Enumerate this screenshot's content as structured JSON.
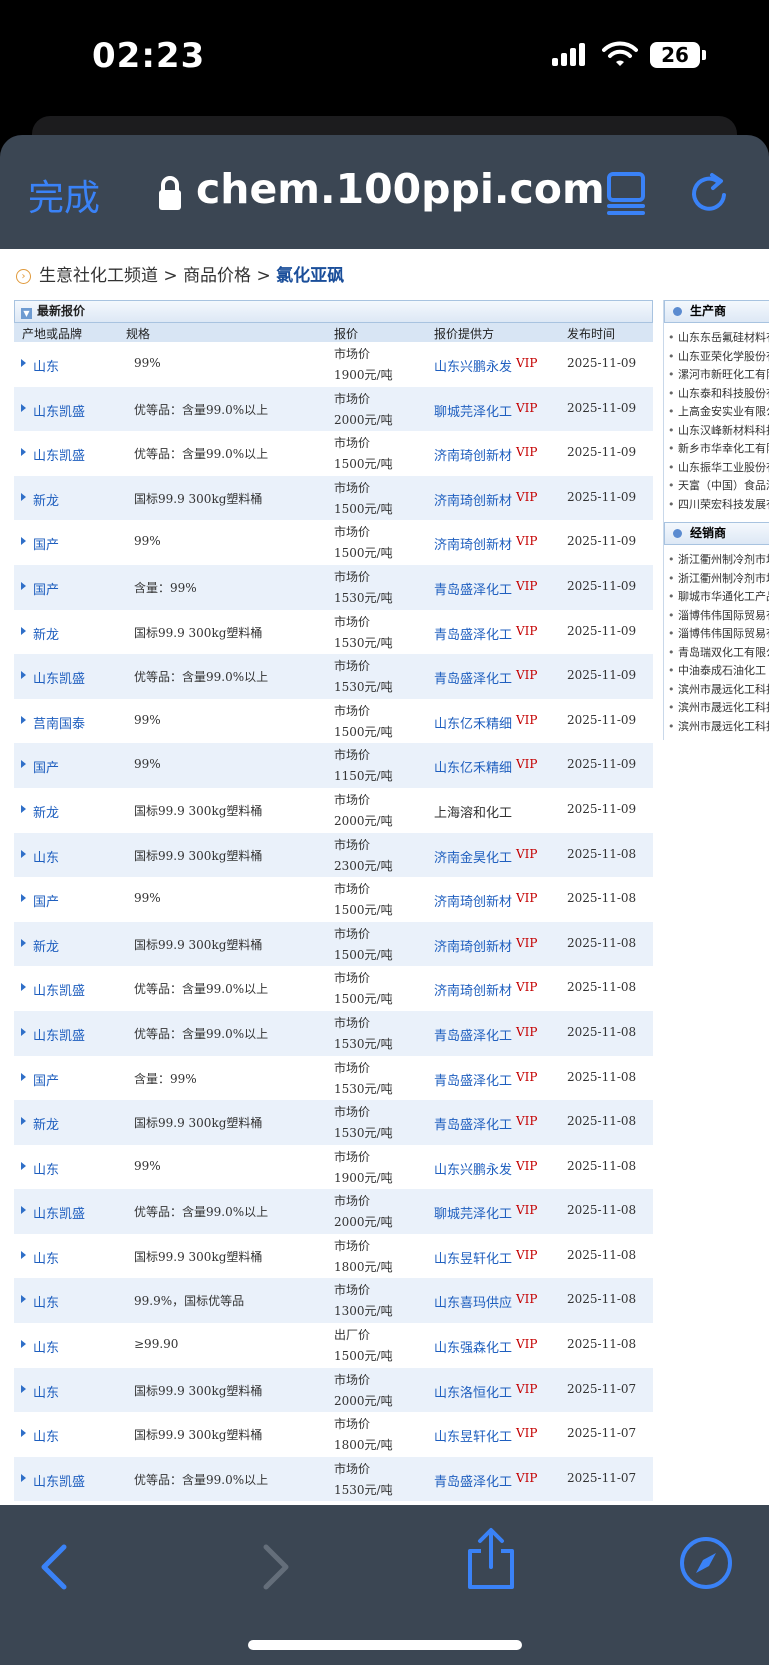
{
  "status": {
    "time": "02:23",
    "battery": "26"
  },
  "browser": {
    "done_label": "完成",
    "url": "chem.100ppi.com"
  },
  "breadcrumb": {
    "part1": "生意社化工频道",
    "sep": " > ",
    "part2": "商品价格",
    "current": "氯化亚砜"
  },
  "quotes": {
    "title": "最新报价",
    "headers": {
      "origin": "产地或品牌",
      "spec": "规格",
      "price": "报价",
      "supplier": "报价提供方",
      "date": "发布时间"
    },
    "rows": [
      {
        "origin": "山东",
        "spec": "99%",
        "ptype": "市场价",
        "price": "1900元/吨",
        "supplier": "山东兴鹏永发",
        "vip": "VIP",
        "date": "2025-11-09"
      },
      {
        "origin": "山东凯盛",
        "spec": "优等品：含量99.0%以上",
        "ptype": "市场价",
        "price": "2000元/吨",
        "supplier": "聊城芫泽化工",
        "vip": "VIP",
        "date": "2025-11-09"
      },
      {
        "origin": "山东凯盛",
        "spec": "优等品：含量99.0%以上",
        "ptype": "市场价",
        "price": "1500元/吨",
        "supplier": "济南琦创新材",
        "vip": "VIP",
        "date": "2025-11-09"
      },
      {
        "origin": "新龙",
        "spec": "国标99.9 300kg塑料桶",
        "ptype": "市场价",
        "price": "1500元/吨",
        "supplier": "济南琦创新材",
        "vip": "VIP",
        "date": "2025-11-09"
      },
      {
        "origin": "国产",
        "spec": "99%",
        "ptype": "市场价",
        "price": "1500元/吨",
        "supplier": "济南琦创新材",
        "vip": "VIP",
        "date": "2025-11-09"
      },
      {
        "origin": "国产",
        "spec": "含量：99%",
        "ptype": "市场价",
        "price": "1530元/吨",
        "supplier": "青岛盛泽化工",
        "vip": "VIP",
        "date": "2025-11-09"
      },
      {
        "origin": "新龙",
        "spec": "国标99.9 300kg塑料桶",
        "ptype": "市场价",
        "price": "1530元/吨",
        "supplier": "青岛盛泽化工",
        "vip": "VIP",
        "date": "2025-11-09"
      },
      {
        "origin": "山东凯盛",
        "spec": "优等品：含量99.0%以上",
        "ptype": "市场价",
        "price": "1530元/吨",
        "supplier": "青岛盛泽化工",
        "vip": "VIP",
        "date": "2025-11-09"
      },
      {
        "origin": "莒南国泰",
        "spec": "99%",
        "ptype": "市场价",
        "price": "1500元/吨",
        "supplier": "山东亿禾精细",
        "vip": "VIP",
        "date": "2025-11-09"
      },
      {
        "origin": "国产",
        "spec": "99%",
        "ptype": "市场价",
        "price": "1150元/吨",
        "supplier": "山东亿禾精细",
        "vip": "VIP",
        "date": "2025-11-09"
      },
      {
        "origin": "新龙",
        "spec": "国标99.9 300kg塑料桶",
        "ptype": "市场价",
        "price": "2000元/吨",
        "supplier": "上海溶和化工",
        "vip": "",
        "date": "2025-11-09"
      },
      {
        "origin": "山东",
        "spec": "国标99.9 300kg塑料桶",
        "ptype": "市场价",
        "price": "2300元/吨",
        "supplier": "济南金昊化工",
        "vip": "VIP",
        "date": "2025-11-08"
      },
      {
        "origin": "国产",
        "spec": "99%",
        "ptype": "市场价",
        "price": "1500元/吨",
        "supplier": "济南琦创新材",
        "vip": "VIP",
        "date": "2025-11-08"
      },
      {
        "origin": "新龙",
        "spec": "国标99.9 300kg塑料桶",
        "ptype": "市场价",
        "price": "1500元/吨",
        "supplier": "济南琦创新材",
        "vip": "VIP",
        "date": "2025-11-08"
      },
      {
        "origin": "山东凯盛",
        "spec": "优等品：含量99.0%以上",
        "ptype": "市场价",
        "price": "1500元/吨",
        "supplier": "济南琦创新材",
        "vip": "VIP",
        "date": "2025-11-08"
      },
      {
        "origin": "山东凯盛",
        "spec": "优等品：含量99.0%以上",
        "ptype": "市场价",
        "price": "1530元/吨",
        "supplier": "青岛盛泽化工",
        "vip": "VIP",
        "date": "2025-11-08"
      },
      {
        "origin": "国产",
        "spec": "含量：99%",
        "ptype": "市场价",
        "price": "1530元/吨",
        "supplier": "青岛盛泽化工",
        "vip": "VIP",
        "date": "2025-11-08"
      },
      {
        "origin": "新龙",
        "spec": "国标99.9 300kg塑料桶",
        "ptype": "市场价",
        "price": "1530元/吨",
        "supplier": "青岛盛泽化工",
        "vip": "VIP",
        "date": "2025-11-08"
      },
      {
        "origin": "山东",
        "spec": "99%",
        "ptype": "市场价",
        "price": "1900元/吨",
        "supplier": "山东兴鹏永发",
        "vip": "VIP",
        "date": "2025-11-08"
      },
      {
        "origin": "山东凯盛",
        "spec": "优等品：含量99.0%以上",
        "ptype": "市场价",
        "price": "2000元/吨",
        "supplier": "聊城芫泽化工",
        "vip": "VIP",
        "date": "2025-11-08"
      },
      {
        "origin": "山东",
        "spec": "国标99.9 300kg塑料桶",
        "ptype": "市场价",
        "price": "1800元/吨",
        "supplier": "山东昱轩化工",
        "vip": "VIP",
        "date": "2025-11-08"
      },
      {
        "origin": "山东",
        "spec": "99.9%，国标优等品",
        "ptype": "市场价",
        "price": "1300元/吨",
        "supplier": "山东喜玛供应",
        "vip": "VIP",
        "date": "2025-11-08"
      },
      {
        "origin": "山东",
        "spec": "≥99.90",
        "ptype": "出厂价",
        "price": "1500元/吨",
        "supplier": "山东强森化工",
        "vip": "VIP",
        "date": "2025-11-08"
      },
      {
        "origin": "山东",
        "spec": "国标99.9 300kg塑料桶",
        "ptype": "市场价",
        "price": "2000元/吨",
        "supplier": "山东洛恒化工",
        "vip": "VIP",
        "date": "2025-11-07"
      },
      {
        "origin": "山东",
        "spec": "国标99.9 300kg塑料桶",
        "ptype": "市场价",
        "price": "1800元/吨",
        "supplier": "山东昱轩化工",
        "vip": "VIP",
        "date": "2025-11-07"
      },
      {
        "origin": "山东凯盛",
        "spec": "优等品：含量99.0%以上",
        "ptype": "市场价",
        "price": "1530元/吨",
        "supplier": "青岛盛泽化工",
        "vip": "VIP",
        "date": "2025-11-07"
      }
    ]
  },
  "producers": {
    "title": "生产商",
    "items": [
      "山东东岳氟硅材料有",
      "山东亚荣化学股份有",
      "漯河市新旺化工有限",
      "山东泰和科技股份有",
      "上高金安实业有限公",
      "山东汉峰新材料科技",
      "新乡市华幸化工有限",
      "山东振华工业股份有",
      "天富（中国）食品添",
      "四川荣宏科技发展有"
    ]
  },
  "distributors": {
    "title": "经销商",
    "items": [
      "浙江衢州制冷剂市场",
      "浙江衢州制冷剂市场",
      "聊城市华通化工产品",
      "淄博伟伟国际贸易有",
      "淄博伟伟国际贸易有",
      "青岛瑞双化工有限公",
      "中油泰成石油化工",
      "滨州市晟远化工科技",
      "滨州市晟远化工科技",
      "滨州市晟远化工科技"
    ]
  },
  "colors": {
    "link": "#1f5fbf",
    "vip": "#c40000",
    "toolbar": "#3b4653",
    "accent": "#3a82f7"
  },
  "icons": [
    "lock-icon",
    "reader-icon",
    "reload-icon",
    "back-icon",
    "forward-icon",
    "share-icon",
    "compass-icon"
  ]
}
